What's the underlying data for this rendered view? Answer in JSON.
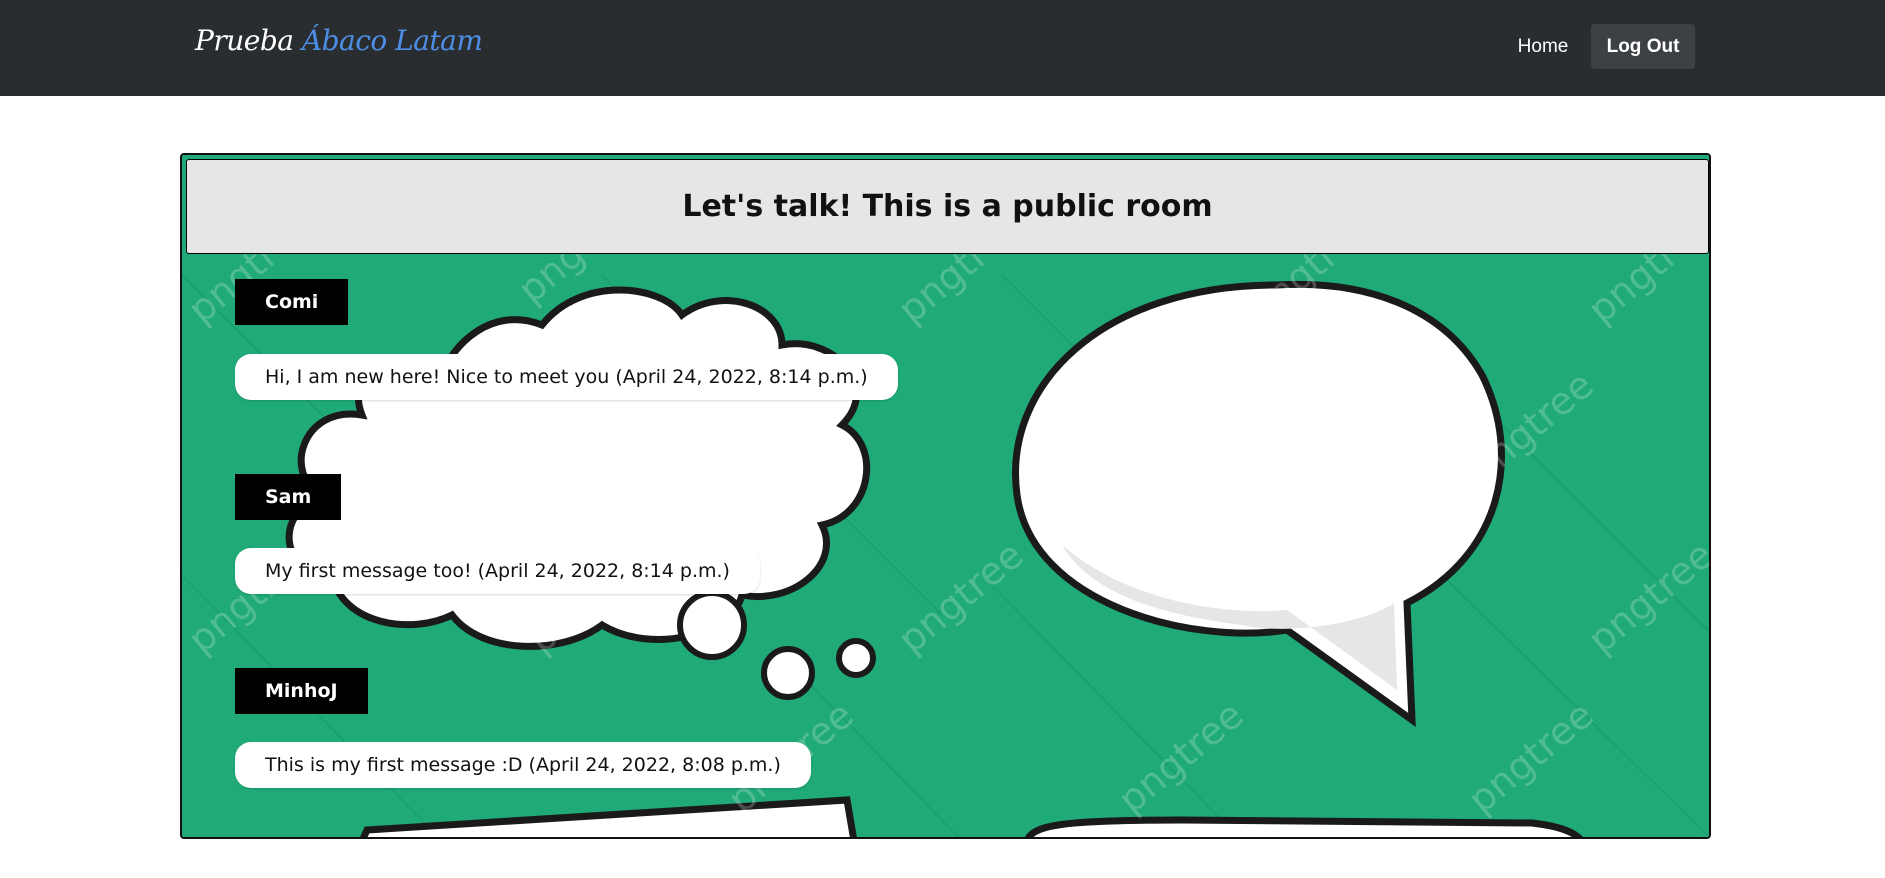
{
  "navbar": {
    "brand_main": "Prueba",
    "brand_accent": "Ábaco Latam",
    "home_label": "Home",
    "logout_label": "Log Out"
  },
  "room": {
    "title": "Let's talk! This is a public room",
    "watermark": "pngtree",
    "messages": [
      {
        "user": "Comi",
        "text": "Hi, I am new here! Nice to meet you (April 24, 2022, 8:14 p.m.)"
      },
      {
        "user": "Sam",
        "text": "My first message too! (April 24, 2022, 8:14 p.m.)"
      },
      {
        "user": "MinhoJ",
        "text": "This is my first message :D (April 24, 2022, 8:08 p.m.)"
      }
    ]
  },
  "colors": {
    "navbar": "#2a2d30",
    "brand_accent": "#4d8fe6",
    "room_background": "#1faa77",
    "header_background": "#e6e6e6"
  }
}
